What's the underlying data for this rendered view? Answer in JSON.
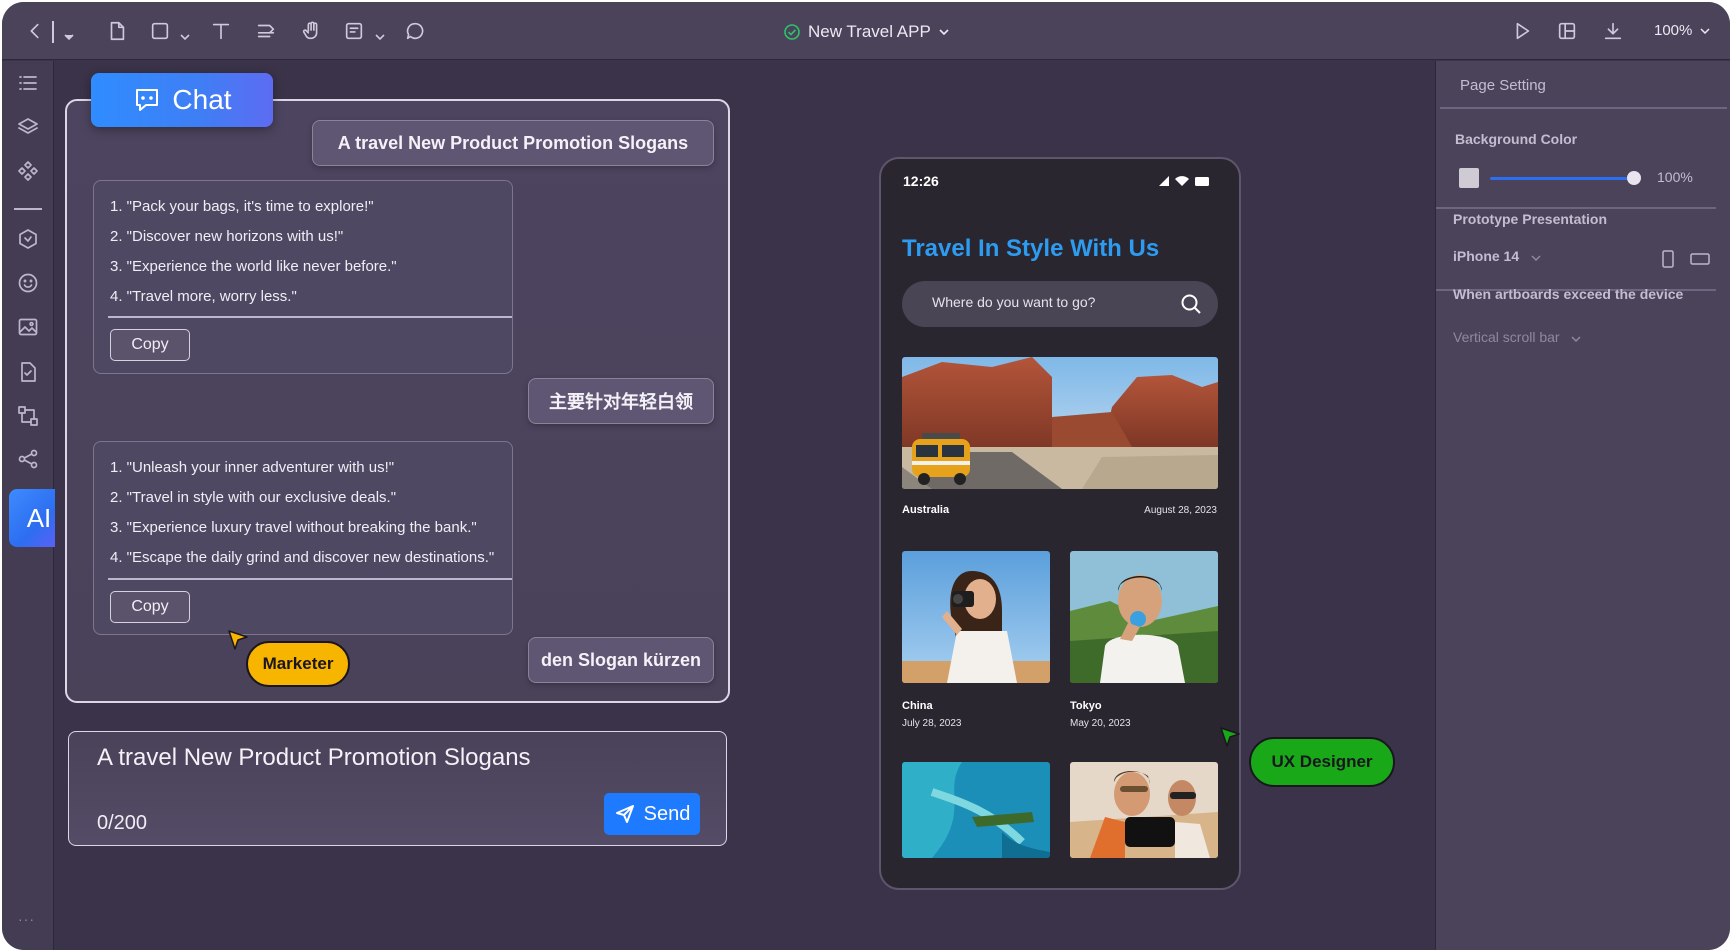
{
  "toolbar": {
    "doc_title": "New Travel APP",
    "zoom": "100%"
  },
  "rail": {
    "ai_label": "AI"
  },
  "chat": {
    "tab_label": "Chat",
    "messages": [
      {
        "role": "user",
        "text": "A travel New Product Promotion Slogans"
      },
      {
        "role": "ai",
        "items": [
          "1. \"Pack your bags, it's time to explore!\"",
          "2. \"Discover new horizons with us!\"",
          "3. \"Experience the world like never before.\"",
          "4. \"Travel more, worry less.\""
        ],
        "copy_label": "Copy"
      },
      {
        "role": "user",
        "text": "主要针对年轻白领"
      },
      {
        "role": "ai",
        "items": [
          "1. \"Unleash your inner adventurer with us!\"",
          "2. \"Travel in style with our exclusive deals.\"",
          "3. \"Experience luxury travel without breaking the bank.\"",
          "4. \"Escape the daily grind and discover new destinations.\""
        ],
        "copy_label": "Copy"
      },
      {
        "role": "user",
        "text": "den Slogan kürzen"
      }
    ],
    "input_value": "A travel New Product Promotion Slogans",
    "char_count": "0/200",
    "send_label": "Send"
  },
  "cursors": {
    "marketer": {
      "label": "Marketer",
      "color": "#f7b500"
    },
    "designer": {
      "label": "UX Designer",
      "color": "#18a818"
    }
  },
  "phone": {
    "time": "12:26",
    "title": "Travel In Style With Us",
    "search_placeholder": "Where do you want to go?",
    "featured": {
      "label": "Australia",
      "date": "August 28, 2023"
    },
    "cards": [
      {
        "label": "China",
        "date": "July 28, 2023"
      },
      {
        "label": "Tokyo",
        "date": "May 20, 2023"
      }
    ]
  },
  "right_panel": {
    "page_setting": "Page Setting",
    "background_color": "Background Color",
    "opacity": "100%",
    "prototype_presentation": "Prototype Presentation",
    "device": "iPhone 14",
    "exceed_label": "When artboards exceed the device",
    "scroll_option": "Vertical scroll bar"
  },
  "colors": {
    "accent": "#1e7bff",
    "title_blue": "#2d9cf0",
    "background": "#3a3349"
  }
}
